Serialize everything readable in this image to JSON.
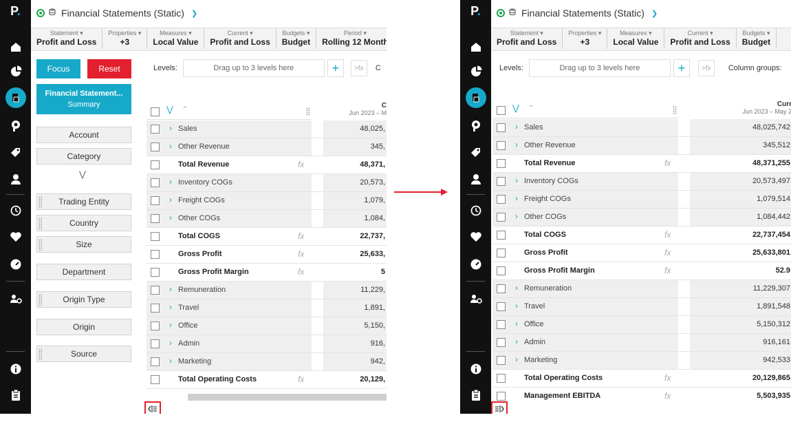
{
  "app": {
    "title": "Financial Statements (Static)",
    "logo": "P",
    "logo_dot": "."
  },
  "rail_icons": [
    "home-icon",
    "pie-chart-icon",
    "financial-statements-icon",
    "analysis-icon",
    "tag-icon",
    "user-icon",
    "history-icon",
    "heart-icon",
    "speedometer-icon",
    "user-settings-icon",
    "info-icon",
    "clipboard-icon"
  ],
  "filters": [
    {
      "label": "Statement",
      "value": "Profit and Loss"
    },
    {
      "label": "Properties",
      "value": "+3"
    },
    {
      "label": "Measures",
      "value": "Local Value"
    },
    {
      "label": "Current",
      "value": "Profit and Loss"
    },
    {
      "label": "Budgets",
      "value": "Budget"
    },
    {
      "label": "Period",
      "value": "Rolling 12 Month"
    }
  ],
  "focus_label": "Focus",
  "reset_label": "Reset",
  "fs_summary": {
    "title": "Financial Statement...",
    "subtitle": "Summary"
  },
  "dimensions_top": [
    "Account",
    "Category"
  ],
  "dimensions_grip": [
    "Trading Entity",
    "Country",
    "Size"
  ],
  "dimensions_bottom": [
    "Department"
  ],
  "dimensions_grip2": [
    "Origin Type"
  ],
  "dimensions_plain2": [
    "Origin"
  ],
  "dimensions_grip3": [
    "Source"
  ],
  "levels": {
    "label": "Levels:",
    "placeholder": "Drag up to 3 levels here",
    "fx": ">fx",
    "column_groups_label": "Column groups:",
    "column_groups_cut": "C"
  },
  "column_header": {
    "right_title": "Curr",
    "right_range": "Jun 2023 – May 2",
    "left_title": "C",
    "left_range": "Jun 2023 – M"
  },
  "left_values": [
    "48,025,",
    "345,",
    "48,371,",
    "20,573,",
    "1,079,",
    "1,084,",
    "22,737,",
    "25,633,",
    "5",
    "11,229,",
    "1,891,",
    "5,150,",
    "916,",
    "942,",
    "20,129,"
  ],
  "rows": [
    {
      "type": "item",
      "label": "Sales",
      "value": "48,025,742"
    },
    {
      "type": "item",
      "label": "Other Revenue",
      "value": "345,512"
    },
    {
      "type": "total",
      "label": "Total Revenue",
      "value": "48,371,255"
    },
    {
      "type": "item",
      "label": "Inventory COGs",
      "value": "20,573,497"
    },
    {
      "type": "item",
      "label": "Freight COGs",
      "value": "1,079,514"
    },
    {
      "type": "item",
      "label": "Other COGs",
      "value": "1,084,442"
    },
    {
      "type": "total",
      "label": "Total COGS",
      "value": "22,737,454"
    },
    {
      "type": "total",
      "label": "Gross Profit",
      "value": "25,633,801"
    },
    {
      "type": "total",
      "label": "Gross Profit Margin",
      "value": "52.9"
    },
    {
      "type": "item",
      "label": "Remuneration",
      "value": "11,229,307"
    },
    {
      "type": "item",
      "label": "Travel",
      "value": "1,891,548"
    },
    {
      "type": "item",
      "label": "Office",
      "value": "5,150,312"
    },
    {
      "type": "item",
      "label": "Admin",
      "value": "916,161"
    },
    {
      "type": "item",
      "label": "Marketing",
      "value": "942,533"
    },
    {
      "type": "total",
      "label": "Total Operating Costs",
      "value": "20,129,865"
    },
    {
      "type": "total",
      "label": "Management EBITDA",
      "value": "5,503,935"
    }
  ],
  "fx_symbol": "fx",
  "colors": {
    "accent": "#17a9c9",
    "reset": "#e3202d",
    "rail": "#111111",
    "highlight": "#e3202d"
  }
}
